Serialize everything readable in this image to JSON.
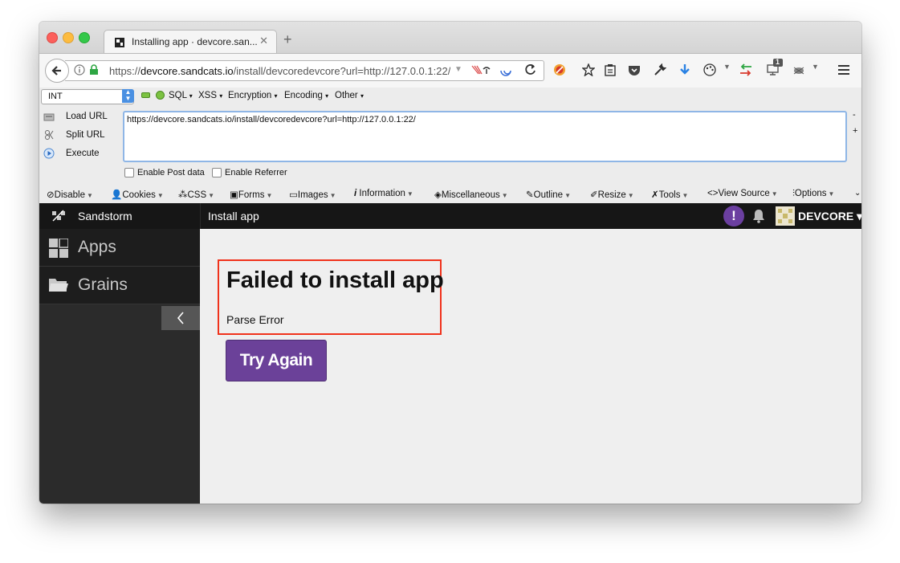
{
  "browser": {
    "tab_title": "Installing app · devcore.san...",
    "tab_close": "✕",
    "new_tab": "+",
    "url_prefix": "https://",
    "url_host": "devcore.sandcats.io",
    "url_path": "/install/devcoredevcore?url=http://127.0.0.1:22/",
    "nav_badge_count": "1"
  },
  "hackbar": {
    "select_value": "INT",
    "menus": [
      "SQL",
      "XSS",
      "Encryption",
      "Encoding",
      "Other"
    ],
    "actions": [
      "Load URL",
      "Split URL",
      "Execute"
    ],
    "textarea_value": "https://devcore.sandcats.io/install/devcoredevcore?url=http://127.0.0.1:22/",
    "minus": "-",
    "plus": "+",
    "enable_post": "Enable Post data",
    "enable_referrer": "Enable Referrer"
  },
  "webdev": {
    "items": [
      "Disable",
      "Cookies",
      "CSS",
      "Forms",
      "Images",
      "Information",
      "Miscellaneous",
      "Outline",
      "Resize",
      "Tools",
      "View Source",
      "Options"
    ]
  },
  "sandstorm": {
    "brand": "Sandstorm",
    "nav": [
      "Apps",
      "Grains"
    ],
    "page_title": "Install app",
    "alert_icon": "!",
    "user_name": "DEVCORE ▾",
    "error_title": "Failed to install app",
    "error_message": "Parse Error",
    "retry_label": "Try Again"
  },
  "colors": {
    "accent_purple": "#6b4199",
    "highlight_red": "#f0321b",
    "sidebar_bg": "#2b2b2b"
  }
}
